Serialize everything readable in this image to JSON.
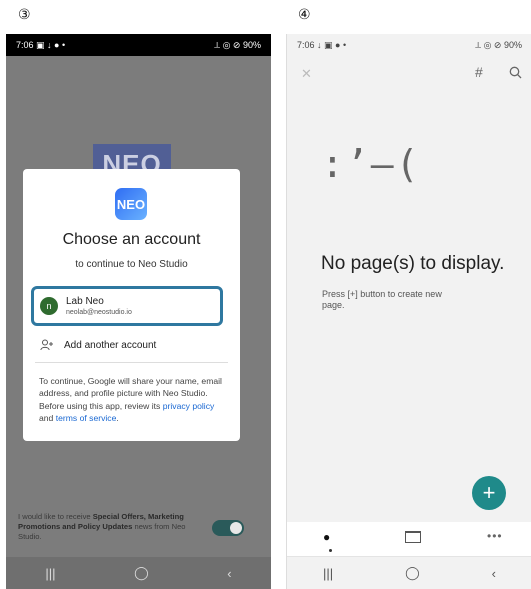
{
  "steps": {
    "three": "③",
    "four": "④"
  },
  "phone3": {
    "status": {
      "time": "7:06",
      "left_icons": "▣ ↓ ● •",
      "right_icons": "⟂ ◎ ⊘",
      "battery": "90%"
    },
    "background_logo": "NEO",
    "dialog": {
      "app_icon": "NEO",
      "title": "Choose an account",
      "subtitle": "to continue to Neo Studio",
      "account": {
        "initial": "n",
        "name": "Lab Neo",
        "email": "neolab@neostudio.io"
      },
      "add_account": "Add another account",
      "disclaimer_prefix": "To continue, Google will share your name, email address, and profile picture with Neo Studio. Before using this app, review its ",
      "privacy_link": "privacy policy",
      "and_text": " and ",
      "terms_link": "terms of service",
      "period": "."
    },
    "promo": {
      "pre": "I would like to receive ",
      "bold": "Special Offers, Marketing Promotions and Policy Updates",
      "post": " news from Neo Studio."
    },
    "nav": {
      "recents": "|||",
      "home": "◯",
      "back": "‹"
    }
  },
  "phone4": {
    "status": {
      "time": "7:06",
      "left_icons": "↓ ▣ ● •",
      "right_icons": "⟂ ◎ ⊘",
      "battery": "90%"
    },
    "toolbar": {
      "pen_icon": "✕",
      "hash_icon": "#",
      "search_icon": "⌕"
    },
    "emoticon": ":’–(",
    "empty_title": "No page(s) to display.",
    "empty_hint": "Press [+] button to create new page.",
    "fab": "+",
    "tabs": {
      "clock_icon": "●",
      "more_icon": "•••"
    },
    "nav": {
      "recents": "|||",
      "home": "◯",
      "back": "‹"
    }
  },
  "colors": {
    "accent": "#1f8a8a",
    "highlight": "#2f78a0",
    "link": "#1a68d2"
  }
}
